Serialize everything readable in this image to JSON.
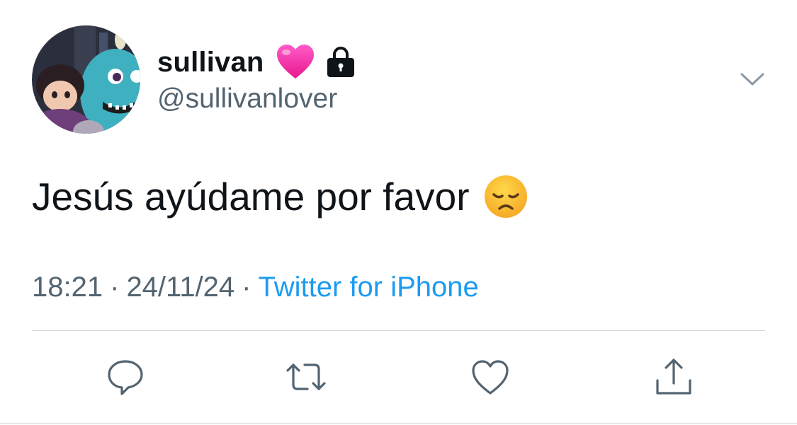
{
  "user": {
    "display_name": "sullivan",
    "handle": "@sullivanlover",
    "avatar_icon": "profile-avatar",
    "name_emoji": "pink-heart",
    "protected_icon": "lock-icon"
  },
  "tweet": {
    "text": "Jesús ayúdame por favor",
    "emoji": "disappointed-face"
  },
  "meta": {
    "time": "18:21",
    "separator": "·",
    "date": "24/11/24",
    "source": "Twitter for iPhone"
  },
  "actions": [
    "reply-icon",
    "retweet-icon",
    "like-icon",
    "share-icon"
  ],
  "colors": {
    "text": "#0f1419",
    "secondary": "#536471",
    "link": "#1d9bf0",
    "divider": "#cfd9de"
  }
}
